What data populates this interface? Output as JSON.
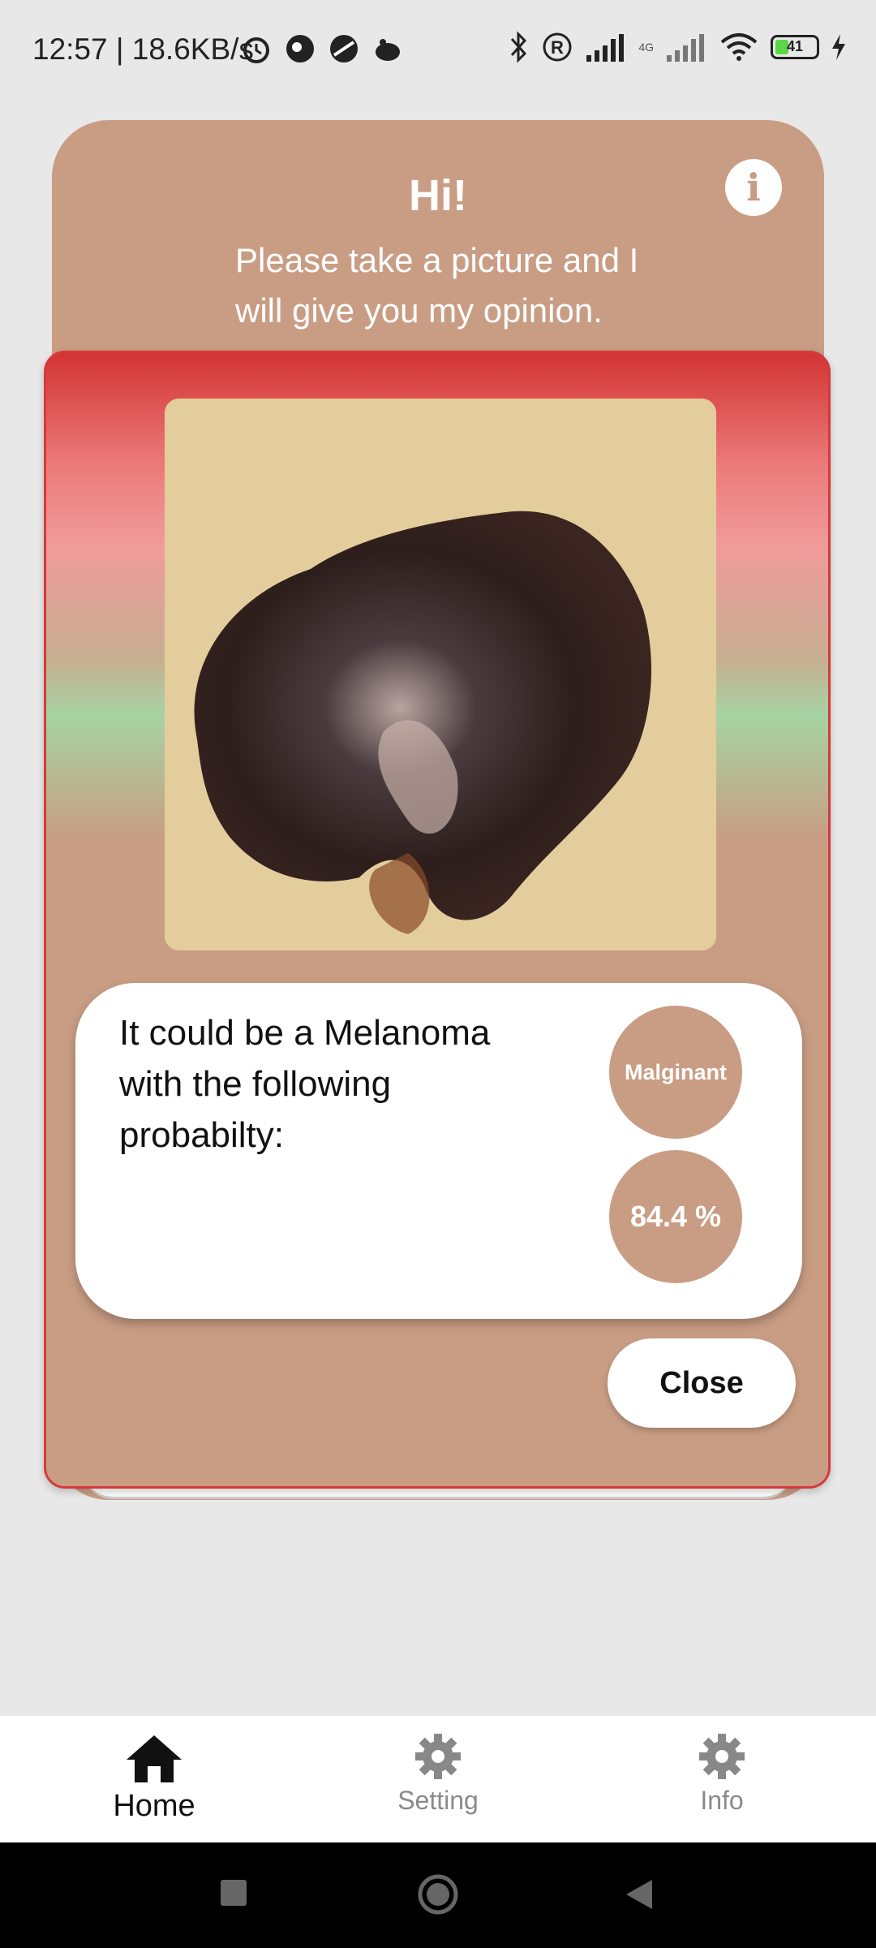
{
  "status_bar": {
    "time_speed": "12:57 | 18.6KB/s",
    "network": "4G",
    "battery": "41"
  },
  "header": {
    "title": "Hi!",
    "subtitle": "Please take a picture and I will give you my opinion.",
    "info_icon": "i"
  },
  "dialog": {
    "image": "skin lesion photo",
    "result_text": "It could be a Melanoma with the following probabilty:",
    "classification": "Malginant",
    "probability": "84.4 %",
    "close_label": "Close"
  },
  "bottom_nav": {
    "items": [
      {
        "label": "Home",
        "icon": "home-icon",
        "active": true
      },
      {
        "label": "Setting",
        "icon": "gear-icon",
        "active": false
      },
      {
        "label": "Info",
        "icon": "gear-icon",
        "active": false
      }
    ]
  },
  "colors": {
    "accent": "#c99d84",
    "dialog_top": "#d33434",
    "dialog_mid": "#a6d3a2"
  }
}
